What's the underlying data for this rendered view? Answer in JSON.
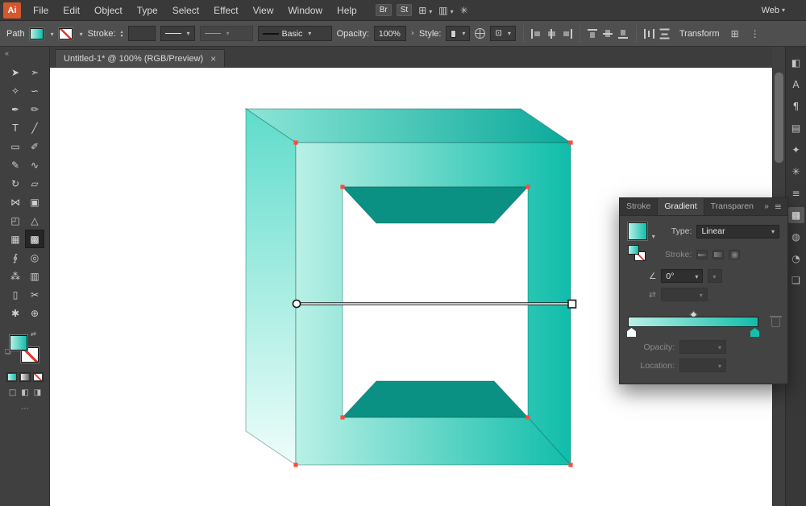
{
  "app": {
    "logo_text": "Ai",
    "workspace_label": "Web"
  },
  "menubar": {
    "menus": [
      "File",
      "Edit",
      "Object",
      "Type",
      "Select",
      "Effect",
      "View",
      "Window",
      "Help"
    ],
    "app_buttons": [
      "Br",
      "St"
    ]
  },
  "control_bar": {
    "selection_type": "Path",
    "stroke_label": "Stroke:",
    "brush_name": "Basic",
    "opacity_label": "Opacity:",
    "opacity_value": "100%",
    "style_label": "Style:",
    "transform_label": "Transform"
  },
  "document_tab": {
    "title": "Untitled-1* @ 100% (RGB/Preview)",
    "close_glyph": "×"
  },
  "toolbar": {
    "collapse_glyph": "«",
    "tools": [
      {
        "name": "selection",
        "glyph": "➤"
      },
      {
        "name": "direct-selection",
        "glyph": "➣"
      },
      {
        "name": "magic-wand",
        "glyph": "✧"
      },
      {
        "name": "lasso",
        "glyph": "∽"
      },
      {
        "name": "pen",
        "glyph": "✒"
      },
      {
        "name": "curvature",
        "glyph": "✏"
      },
      {
        "name": "type",
        "glyph": "T"
      },
      {
        "name": "line-segment",
        "glyph": "╱"
      },
      {
        "name": "rectangle",
        "glyph": "▭"
      },
      {
        "name": "paintbrush",
        "glyph": "✐"
      },
      {
        "name": "pencil",
        "glyph": "✎"
      },
      {
        "name": "shaper",
        "glyph": "∿"
      },
      {
        "name": "rotate",
        "glyph": "↻"
      },
      {
        "name": "scale",
        "glyph": "▱"
      },
      {
        "name": "width",
        "glyph": "⋈"
      },
      {
        "name": "free-transform",
        "glyph": "▣"
      },
      {
        "name": "shape-builder",
        "glyph": "◰"
      },
      {
        "name": "perspective-grid",
        "glyph": "△"
      },
      {
        "name": "mesh",
        "glyph": "▦"
      },
      {
        "name": "gradient",
        "glyph": "▩",
        "selected": true
      },
      {
        "name": "eyedropper",
        "glyph": "∮"
      },
      {
        "name": "blend",
        "glyph": "◎"
      },
      {
        "name": "symbol-sprayer",
        "glyph": "⁂"
      },
      {
        "name": "column-graph",
        "glyph": "▥"
      },
      {
        "name": "artboard",
        "glyph": "▯"
      },
      {
        "name": "slice",
        "glyph": "✂"
      },
      {
        "name": "hand",
        "glyph": "✱"
      },
      {
        "name": "zoom",
        "glyph": "⊕"
      }
    ]
  },
  "gradient_panel": {
    "tabs": [
      {
        "label": "Stroke",
        "active": false
      },
      {
        "label": "Gradient",
        "active": true
      },
      {
        "label": "Transparen",
        "active": false
      }
    ],
    "overflow_glyph": "»",
    "menu_glyph": "≡",
    "type_label": "Type:",
    "type_value": "Linear",
    "stroke_label": "Stroke:",
    "angle_glyph": "∠",
    "angle_value": "0°",
    "reverse_glyph": "⇄",
    "opacity_label": "Opacity:",
    "location_label": "Location:",
    "stops": {
      "left": "#f2fdfb",
      "right": "#12c0ad"
    }
  },
  "right_rail": {
    "icons": [
      {
        "name": "libraries",
        "glyph": "◧"
      },
      {
        "name": "character",
        "glyph": "A"
      },
      {
        "name": "paragraph",
        "glyph": "¶"
      },
      {
        "name": "swatches",
        "glyph": "▤"
      },
      {
        "name": "brushes",
        "glyph": "✦"
      },
      {
        "name": "symbols",
        "glyph": "✳"
      },
      {
        "name": "stroke",
        "glyph": "≡"
      },
      {
        "name": "gradient",
        "glyph": "▩",
        "active": true
      },
      {
        "name": "transparency",
        "glyph": "◍"
      },
      {
        "name": "appearance",
        "glyph": "◔"
      },
      {
        "name": "layers",
        "glyph": "❏"
      }
    ]
  },
  "artwork": {
    "teal_light": "#b9f0e6",
    "teal": "#10bdaa",
    "teal_top_light": "#8ce6d7",
    "teal_top": "#0ba99a",
    "left_band_top": "#5fdccb",
    "left_band_bottom": "#eefdfa",
    "dark_face": "#0a9183",
    "anchor_color": "#ff4b3e"
  }
}
